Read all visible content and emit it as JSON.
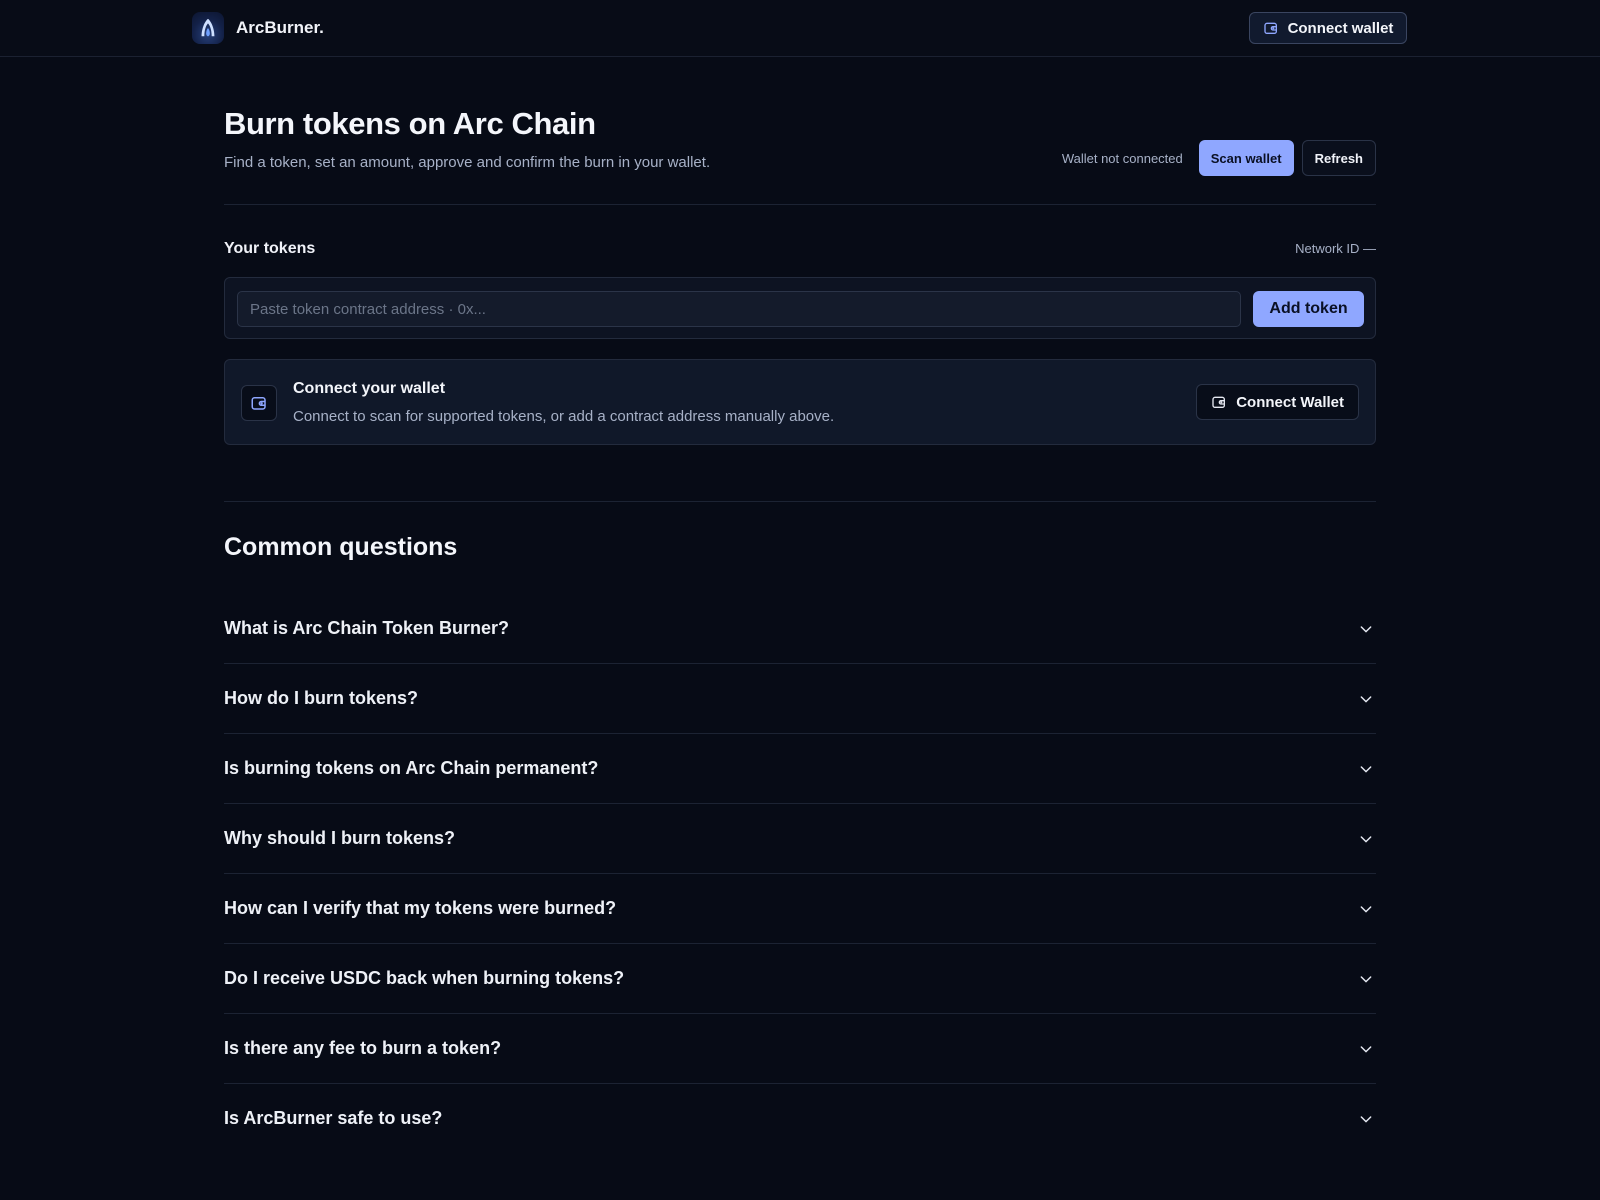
{
  "nav": {
    "brand": "ArcBurner.",
    "logo_icon": "arc-flame-logo",
    "connect_label": "Connect wallet",
    "connect_icon": "wallet-icon"
  },
  "hero": {
    "title": "Burn tokens on Arc Chain",
    "subtitle": "Find a token, set an amount, approve and confirm the burn in your wallet.",
    "wallet_status": "Wallet not connected",
    "scan_label": "Scan wallet",
    "refresh_label": "Refresh"
  },
  "tokens": {
    "title": "Your tokens",
    "network_id": "Network ID —",
    "input_placeholder": "Paste token contract address · 0x...",
    "input_value": "",
    "add_label": "Add token"
  },
  "connect_card": {
    "icon": "wallet-icon",
    "title": "Connect your wallet",
    "description": "Connect to scan for supported tokens, or add a contract address manually above.",
    "button_label": "Connect Wallet"
  },
  "faq": {
    "title": "Common questions",
    "items": [
      "What is Arc Chain Token Burner?",
      "How do I burn tokens?",
      "Is burning tokens on Arc Chain permanent?",
      "Why should I burn tokens?",
      "How can I verify that my tokens were burned?",
      "Do I receive USDC back when burning tokens?",
      "Is there any fee to burn a token?",
      "Is ArcBurner safe to use?"
    ]
  },
  "colors": {
    "background": "#070b16",
    "accent": "#8fa7ff",
    "muted_text": "#a7b1c7",
    "border": "#232b3d"
  }
}
